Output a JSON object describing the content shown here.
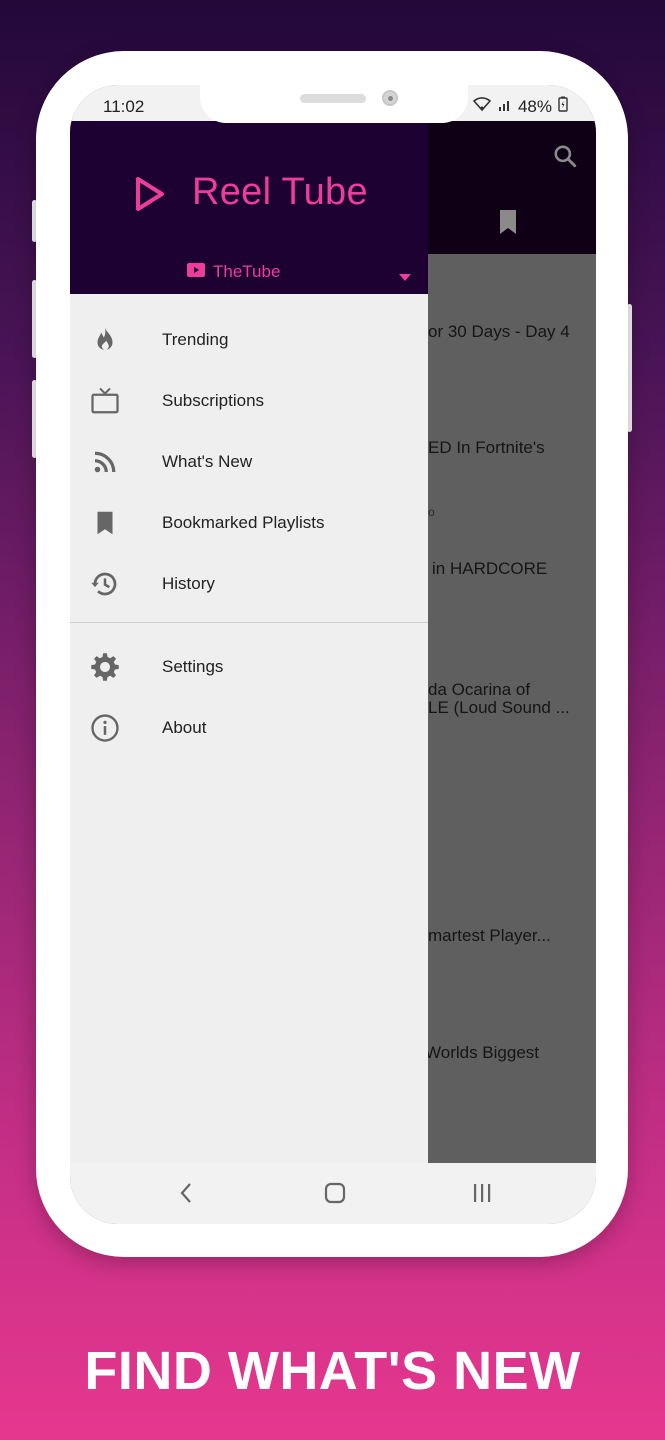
{
  "status_bar": {
    "time": "11:02",
    "battery": "48%"
  },
  "app": {
    "name": "Reel Tube",
    "service": "TheTube"
  },
  "menu": {
    "primary": [
      {
        "label": "Trending",
        "icon": "fire-icon"
      },
      {
        "label": "Subscriptions",
        "icon": "tv-icon"
      },
      {
        "label": "What's New",
        "icon": "rss-icon"
      },
      {
        "label": "Bookmarked Playlists",
        "icon": "bookmark-icon"
      },
      {
        "label": "History",
        "icon": "history-icon"
      }
    ],
    "secondary": [
      {
        "label": "Settings",
        "icon": "gear-icon"
      },
      {
        "label": "About",
        "icon": "info-icon"
      }
    ]
  },
  "background_list": [
    "or 30 Days - Day 4",
    "ED In Fortnite's",
    "o",
    "in HARDCORE",
    "da Ocarina of",
    "LE (Loud Sound ...",
    "martest Player...",
    "Worlds Biggest"
  ],
  "caption": "FIND WHAT'S NEW",
  "colors": {
    "accent": "#ec3d9a",
    "header_bg": "#1d0133",
    "drawer_bg": "#efefef"
  }
}
